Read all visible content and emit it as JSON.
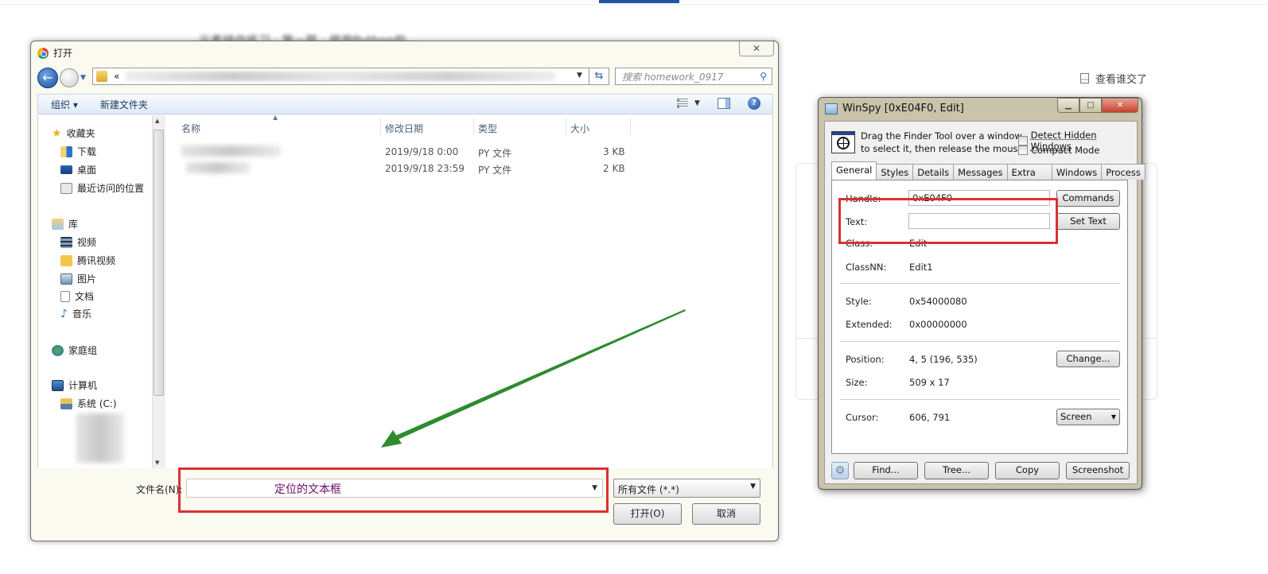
{
  "background_page": {
    "heading_blurred": "元素操作练习 · 第一篇 · 使用Python的...",
    "submitted_link": "查看谁交了"
  },
  "open_dialog": {
    "title": "打开",
    "close_glyph": "✕",
    "address_prefix": "«",
    "search_placeholder": "搜索 homework_0917",
    "toolbar": {
      "organize": "组织 ▾",
      "new_folder": "新建文件夹"
    },
    "sidebar": {
      "favorites": {
        "label": "收藏夹",
        "items": [
          "下载",
          "桌面",
          "最近访问的位置"
        ]
      },
      "libraries": {
        "label": "库",
        "items": [
          "视频",
          "腾讯视频",
          "图片",
          "文档",
          "音乐"
        ]
      },
      "homegroup": "家庭组",
      "computer": {
        "label": "计算机",
        "items": [
          "系统 (C:)"
        ]
      }
    },
    "columns": {
      "name": "名称",
      "modified": "修改日期",
      "type": "类型",
      "size": "大小"
    },
    "files": [
      {
        "name": "",
        "modified": "2019/9/18 0:00",
        "type": "PY 文件",
        "size": "3 KB"
      },
      {
        "name": "",
        "modified": "2019/9/18 23:59",
        "type": "PY 文件",
        "size": "2 KB"
      }
    ],
    "filename_label": "文件名(N):",
    "filename_value": "",
    "filename_annotation": "定位的文本框",
    "filter_value": "所有文件 (*.*)",
    "open_button": "打开(O)",
    "cancel_button": "取消"
  },
  "winspy": {
    "title": "WinSpy [0xE04F0, Edit]",
    "drag_text_line1": "Drag the Finder Tool over a window",
    "drag_text_line2": "to select it, then release the mouse",
    "detect_hidden": "Detect Hidden Windows",
    "compact_mode": "Compact Mode",
    "tabs": [
      "General",
      "Styles",
      "Details",
      "Messages",
      "Extra",
      "Windows",
      "Process"
    ],
    "active_tab": "General",
    "fields": {
      "handle_label": "Handle:",
      "handle_value": "0xE04F0",
      "text_label": "Text:",
      "text_value": "",
      "class_label": "Class:",
      "class_value": "Edit",
      "classnn_label": "ClassNN:",
      "classnn_value": "Edit1",
      "style_label": "Style:",
      "style_value": "0x54000080",
      "extended_label": "Extended:",
      "extended_value": "0x00000000",
      "position_label": "Position:",
      "position_value": "4, 5 (196, 535)",
      "size_label": "Size:",
      "size_value": "509 x 17",
      "cursor_label": "Cursor:",
      "cursor_value": "606, 791"
    },
    "buttons": {
      "commands": "Commands",
      "set_text": "Set Text",
      "change": "Change...",
      "cursor_mode": "Screen",
      "find": "Find...",
      "tree": "Tree...",
      "copy": "Copy",
      "screenshot": "Screenshot"
    }
  },
  "colors": {
    "annotation_red": "#d83232",
    "arrow_green": "#2e8b2e",
    "annotation_text": "#6a0d6a"
  }
}
